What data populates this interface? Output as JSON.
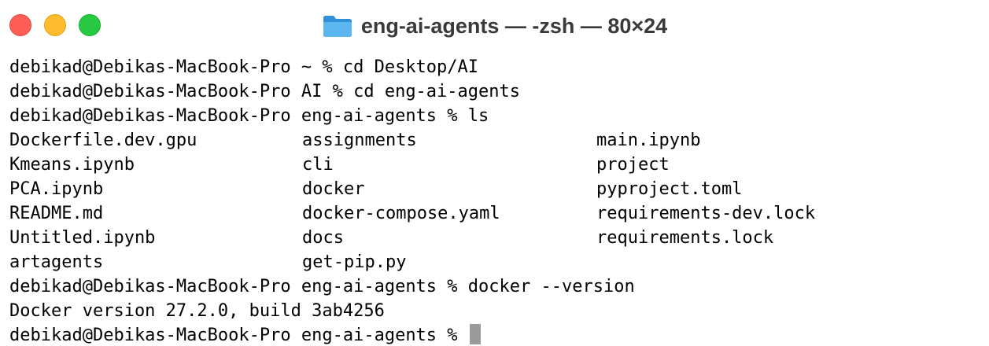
{
  "window": {
    "title": "eng-ai-agents — -zsh — 80×24",
    "folder_icon": "folder-icon",
    "colors": {
      "close": "#ff5f57",
      "minimize": "#febc2e",
      "zoom": "#28c840",
      "folder": "#4aa8e8",
      "cursor": "#9a9a9a"
    }
  },
  "terminal": {
    "commands_before": [
      "debikad@Debikas-MacBook-Pro ~ % cd Desktop/AI",
      "debikad@Debikas-MacBook-Pro AI % cd eng-ai-agents",
      "debikad@Debikas-MacBook-Pro eng-ai-agents % ls"
    ],
    "ls_output": [
      [
        "Dockerfile.dev.gpu",
        "assignments",
        "main.ipynb"
      ],
      [
        "Kmeans.ipynb",
        "cli",
        "project"
      ],
      [
        "PCA.ipynb",
        "docker",
        "pyproject.toml"
      ],
      [
        "README.md",
        "docker-compose.yaml",
        "requirements-dev.lock"
      ],
      [
        "Untitled.ipynb",
        "docs",
        "requirements.lock"
      ],
      [
        "artagents",
        "get-pip.py",
        ""
      ]
    ],
    "commands_after": [
      "debikad@Debikas-MacBook-Pro eng-ai-agents % docker --version",
      "Docker version 27.2.0, build 3ab4256"
    ],
    "current_prompt": "debikad@Debikas-MacBook-Pro eng-ai-agents % "
  }
}
